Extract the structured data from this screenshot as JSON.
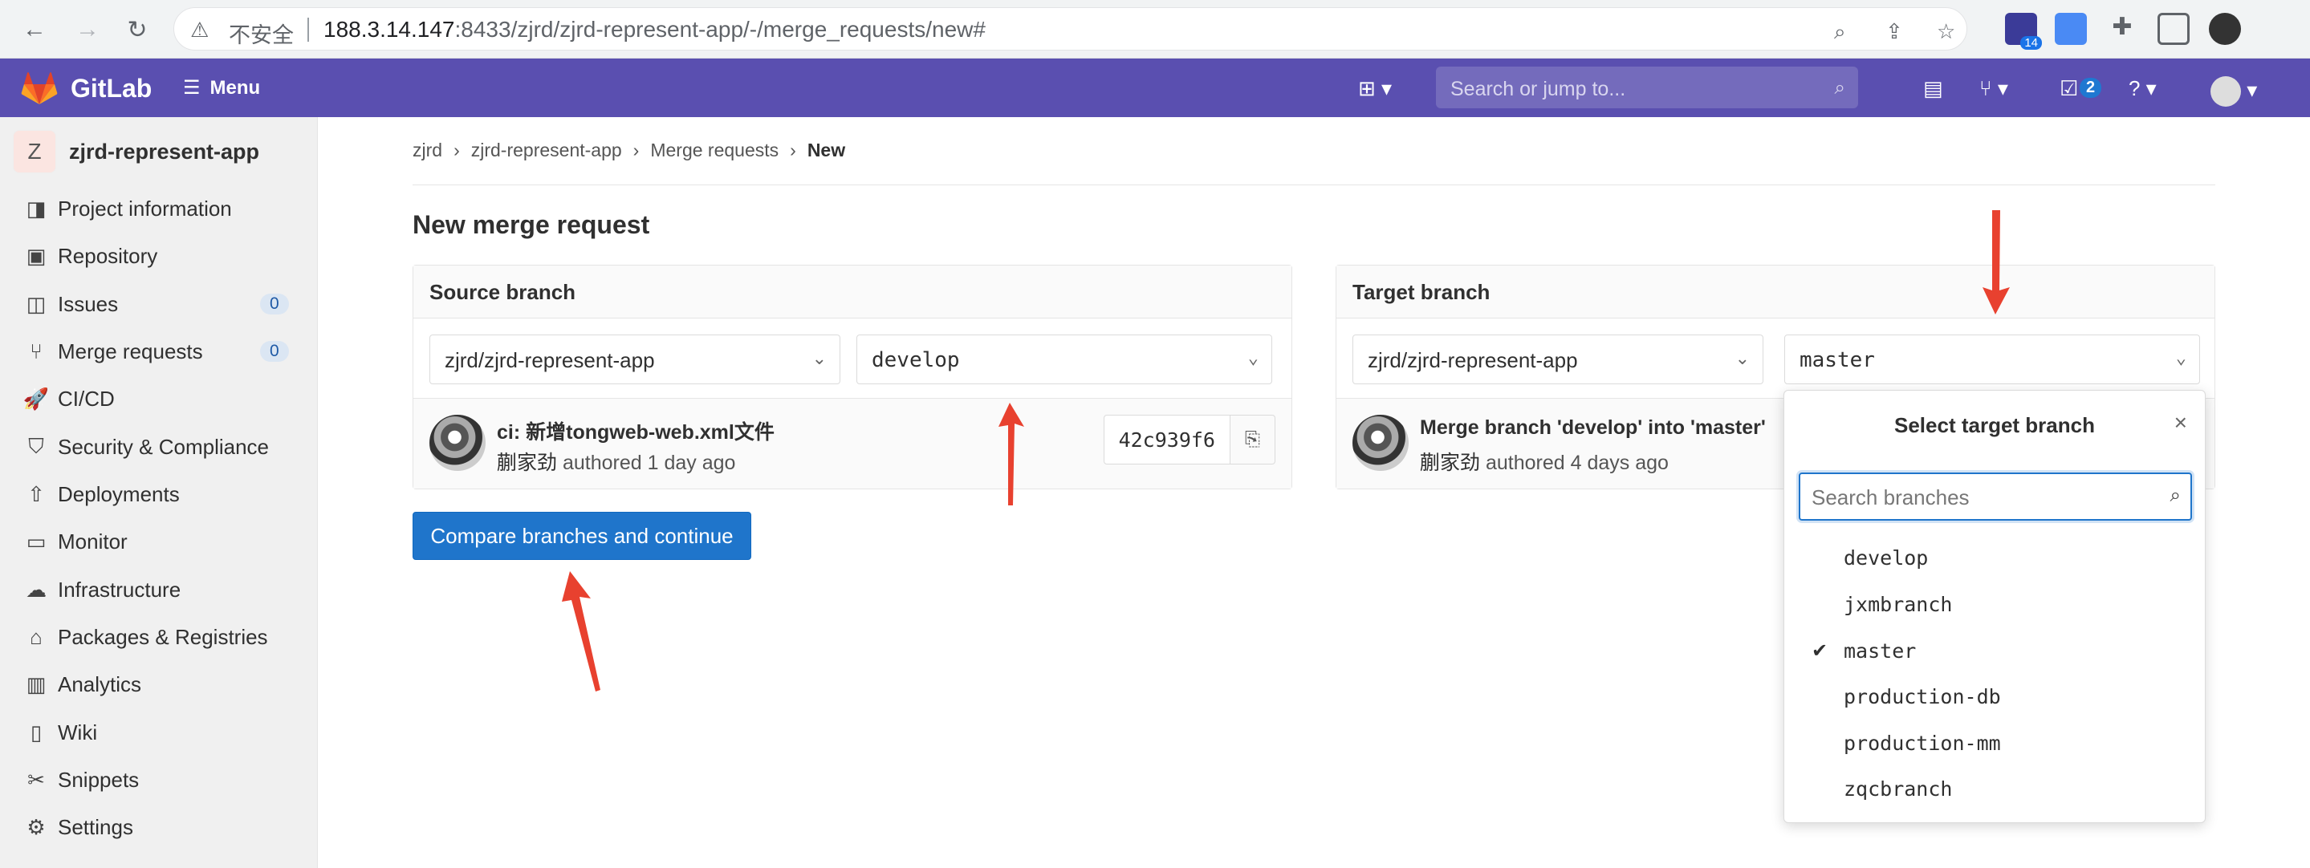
{
  "browser": {
    "insecure_label": "不安全",
    "url_host": "188.3.14.147",
    "url_rest": ":8433/zjrd/zjrd-represent-app/-/merge_requests/new#",
    "ext_badge": "14"
  },
  "header": {
    "brand": "GitLab",
    "menu_label": "Menu",
    "search_placeholder": "Search or jump to...",
    "todo_count": "2"
  },
  "sidebar": {
    "project_initial": "Z",
    "project_name": "zjrd-represent-app",
    "items": [
      {
        "label": "Project information",
        "icon": "project-info-icon"
      },
      {
        "label": "Repository",
        "icon": "repository-icon"
      },
      {
        "label": "Issues",
        "icon": "issues-icon",
        "count": "0"
      },
      {
        "label": "Merge requests",
        "icon": "merge-request-icon",
        "count": "0"
      },
      {
        "label": "CI/CD",
        "icon": "rocket-icon"
      },
      {
        "label": "Security & Compliance",
        "icon": "shield-icon"
      },
      {
        "label": "Deployments",
        "icon": "deployments-icon"
      },
      {
        "label": "Monitor",
        "icon": "monitor-icon"
      },
      {
        "label": "Infrastructure",
        "icon": "cloud-icon"
      },
      {
        "label": "Packages & Registries",
        "icon": "package-icon"
      },
      {
        "label": "Analytics",
        "icon": "chart-icon"
      },
      {
        "label": "Wiki",
        "icon": "book-icon"
      },
      {
        "label": "Snippets",
        "icon": "scissors-icon"
      },
      {
        "label": "Settings",
        "icon": "gear-icon"
      }
    ]
  },
  "breadcrumb": [
    "zjrd",
    "zjrd-represent-app",
    "Merge requests",
    "New"
  ],
  "page_title": "New merge request",
  "source": {
    "header": "Source branch",
    "project": "zjrd/zjrd-represent-app",
    "branch": "develop",
    "commit_message": "ci: 新增tongweb-web.xml文件",
    "author": "蒯家劲",
    "authored": "authored 1 day ago",
    "sha": "42c939f6"
  },
  "target": {
    "header": "Target branch",
    "project": "zjrd/zjrd-represent-app",
    "branch": "master",
    "commit_message": "Merge branch 'develop' into 'master'",
    "author": "蒯家劲",
    "authored": "authored 4 days ago"
  },
  "compare_button": "Compare branches and continue",
  "branch_menu": {
    "title": "Select target branch",
    "search_placeholder": "Search branches",
    "options": [
      {
        "label": "develop",
        "selected": false
      },
      {
        "label": "jxmbranch",
        "selected": false
      },
      {
        "label": "master",
        "selected": true
      },
      {
        "label": "production-db",
        "selected": false
      },
      {
        "label": "production-mm",
        "selected": false
      },
      {
        "label": "zqcbranch",
        "selected": false
      }
    ]
  },
  "colors": {
    "header_bg": "#5a4fb0",
    "primary_button": "#1f75cb",
    "annotation_arrow": "#e8412f"
  }
}
